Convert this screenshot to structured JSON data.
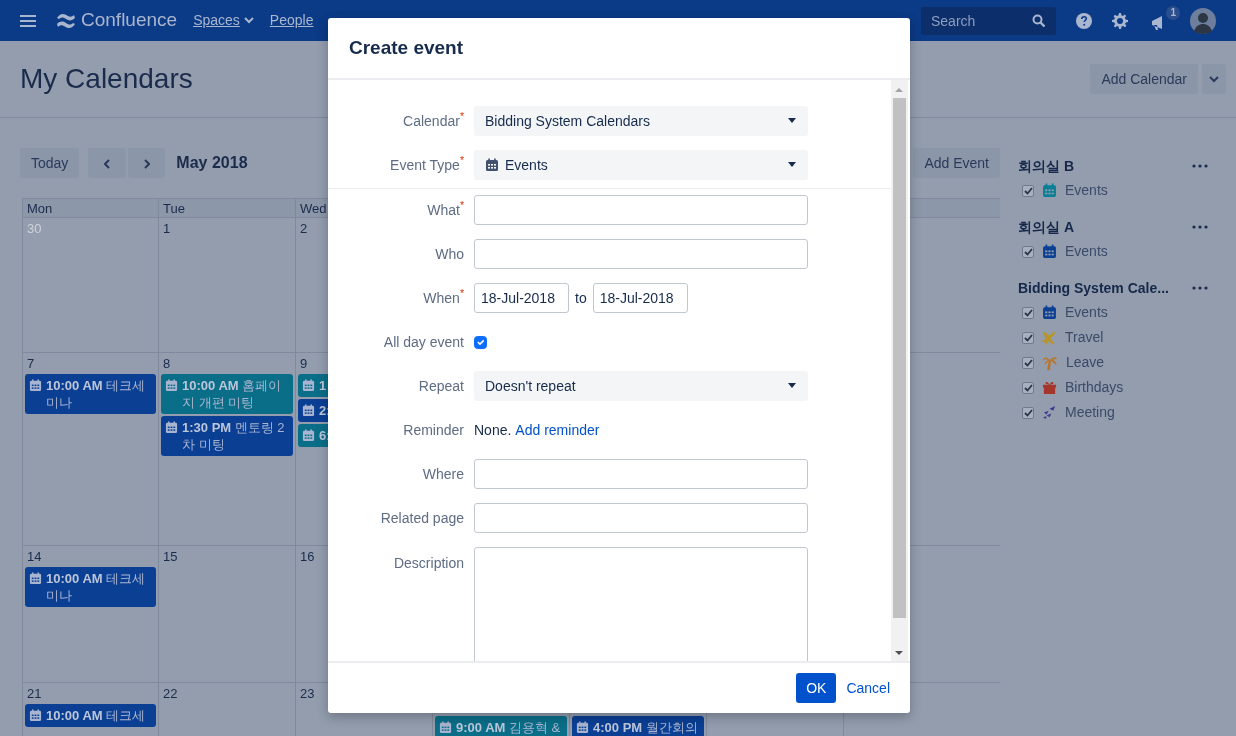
{
  "navbar": {
    "product": "Confluence",
    "links": [
      {
        "label": "Spaces",
        "dropdown": true
      },
      {
        "label": "People",
        "dropdown": false
      }
    ],
    "search": {
      "placeholder": "Search"
    },
    "notification_count": "1"
  },
  "page": {
    "title": "My Calendars",
    "add_calendar": "Add Calendar"
  },
  "toolbar": {
    "today": "Today",
    "month": "May 2018",
    "add_event": "Add Event"
  },
  "calendar": {
    "weekdays": [
      "Mon",
      "Tue",
      "Wed"
    ],
    "weeks": [
      {
        "days": [
          {
            "day": "30",
            "other_month": true
          },
          {
            "day": "1",
            "other_month": false
          },
          {
            "day": "2",
            "other_month": false
          }
        ]
      },
      {
        "days": [
          {
            "day": "7",
            "other_month": false,
            "events": [
              {
                "text": "**10:00 AM** 테크세미나",
                "color": "#0b3f94"
              }
            ]
          },
          {
            "day": "8",
            "other_month": false,
            "events": [
              {
                "text": "**10:00 AM** 홈페이지 개편 미팅",
                "color": "#0a6e88"
              },
              {
                "text": "**1:30 PM** 멘토링 2차 미팅",
                "color": "#0b3f94"
              }
            ]
          },
          {
            "day": "9",
            "other_month": false,
            "events": [
              {
                "text": "**1**",
                "color": "#0a6e88"
              },
              {
                "text": "**2:**",
                "color": "#0b3f94"
              },
              {
                "text": "**6:**",
                "color": "#0a6e88"
              }
            ]
          }
        ]
      },
      {
        "days": [
          {
            "day": "14",
            "other_month": false,
            "events": [
              {
                "text": "**10:00 AM** 테크세미나",
                "color": "#0b3f94"
              }
            ]
          },
          {
            "day": "15",
            "other_month": false
          },
          {
            "day": "16",
            "other_month": false
          }
        ]
      },
      {
        "days": [
          {
            "day": "21",
            "other_month": false,
            "events": [
              {
                "text": "**10:00 AM** 테크세",
                "color": "#0b3f94"
              }
            ]
          },
          {
            "day": "22",
            "other_month": false
          },
          {
            "day": "23",
            "other_month": false
          },
          {
            "events": [
              {
                "text": "**9:00 AM** 김용혁 &",
                "color": "#0a6e88"
              }
            ]
          },
          {
            "events": [
              {
                "text": "**4:00 PM** 월간회의",
                "color": "#0b3f94"
              }
            ]
          }
        ]
      }
    ]
  },
  "sidebar": {
    "groups": [
      {
        "name": "회의실 B",
        "items": [
          {
            "label": "Events",
            "checked": true,
            "kind": "calendar",
            "color": "#0a7f95"
          }
        ]
      },
      {
        "name": "회의실 A",
        "items": [
          {
            "label": "Events",
            "checked": true,
            "kind": "calendar",
            "color": "#0b3f94"
          }
        ]
      },
      {
        "name": "Bidding System Cale...",
        "items": [
          {
            "label": "Events",
            "checked": true,
            "kind": "calendar",
            "color": "#0b3f94"
          },
          {
            "label": "Travel",
            "checked": true,
            "kind": "plane",
            "color": "#b8952a"
          },
          {
            "label": "Leave",
            "checked": true,
            "kind": "palm",
            "color": "#b8762a"
          },
          {
            "label": "Birthdays",
            "checked": true,
            "kind": "gift",
            "color": "#a5362c"
          },
          {
            "label": "Meeting",
            "checked": true,
            "kind": "meeting",
            "color": "#3b3a8c"
          }
        ]
      }
    ]
  },
  "dialog": {
    "title": "Create event",
    "sections": [
      [
        {
          "kind": "select",
          "label": "Calendar$^{*}$",
          "value": "Bidding System Calendars"
        },
        {
          "kind": "icon-select",
          "label": "Event Type$^{*}$",
          "value": "Events"
        }
      ],
      [
        {
          "kind": "text",
          "label": "What$^{*}$"
        },
        {
          "kind": "text",
          "label": "Who"
        },
        {
          "kind": "daterange",
          "label": "When$^{*}$",
          "from": "18-Jul-2018",
          "joiner": "to",
          "to": "18-Jul-2018"
        },
        {
          "kind": "checkbox",
          "label": "All day event",
          "checked": true
        },
        {
          "kind": "select",
          "label": "Repeat",
          "value": "Doesn't repeat"
        },
        {
          "kind": "info",
          "label": "Reminder",
          "text": "None.",
          "link": "Add reminder"
        },
        {
          "kind": "text",
          "label": "Where"
        },
        {
          "kind": "text",
          "label": "Related page"
        },
        {
          "kind": "textarea",
          "label": "Description"
        }
      ]
    ],
    "buttons": [
      {
        "label": "OK",
        "kind": "primary"
      },
      {
        "label": "Cancel",
        "kind": "link"
      }
    ]
  }
}
